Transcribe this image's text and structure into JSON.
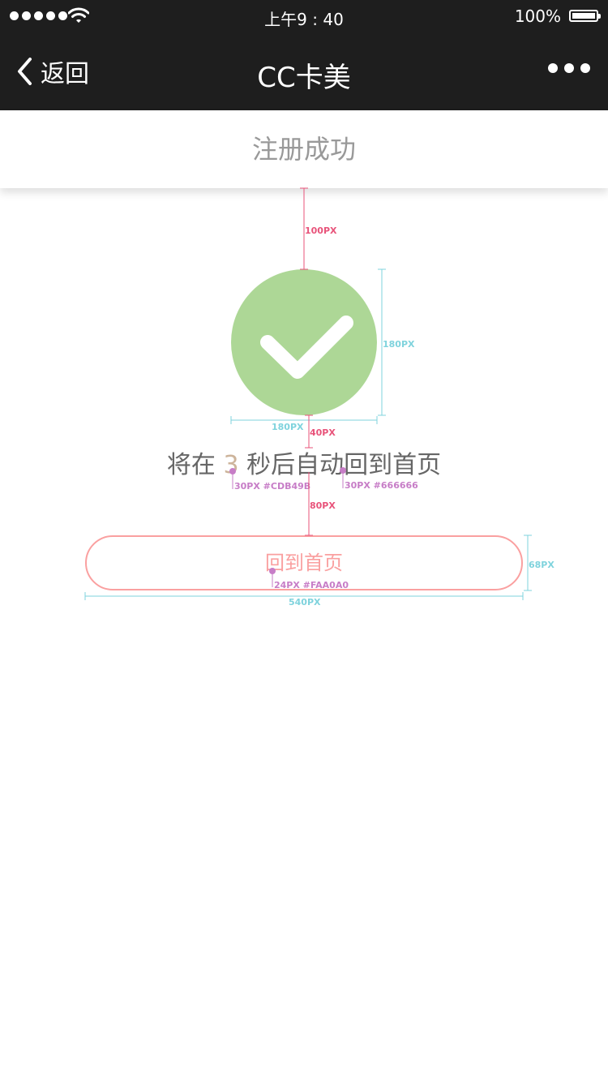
{
  "status_bar": {
    "time": "上午9 : 40",
    "battery_percent": "100%",
    "signal_dots": 5,
    "battery_level": 1.0
  },
  "nav": {
    "back_label": "返回",
    "title": "CC卡美"
  },
  "page": {
    "header": "注册成功"
  },
  "countdown": {
    "prefix": "将在 ",
    "seconds": "3",
    "suffix": " 秒后自动回到首页"
  },
  "home_button": {
    "label": "回到首页"
  },
  "annotations": {
    "gap_top": "100PX",
    "circle_height": "180PX",
    "circle_width": "180PX",
    "gap_text": "40PX",
    "number_spec": "30PX #CDB49B",
    "text_spec": "30PX #666666",
    "gap_button": "80PX",
    "button_height": "68PX",
    "button_spec": "24PX #FAA0A0",
    "button_width": "540PX"
  },
  "colors": {
    "bar_bg": "#1e1e1e",
    "success_green": "#add796",
    "number_color": "#cdb49b",
    "text_color": "#666666",
    "button_color": "#faa0a0",
    "header_text": "#999999",
    "annotation_pink": "#e8537a",
    "annotation_cyan": "#7fd3dd",
    "annotation_purple": "#c77dc7"
  }
}
